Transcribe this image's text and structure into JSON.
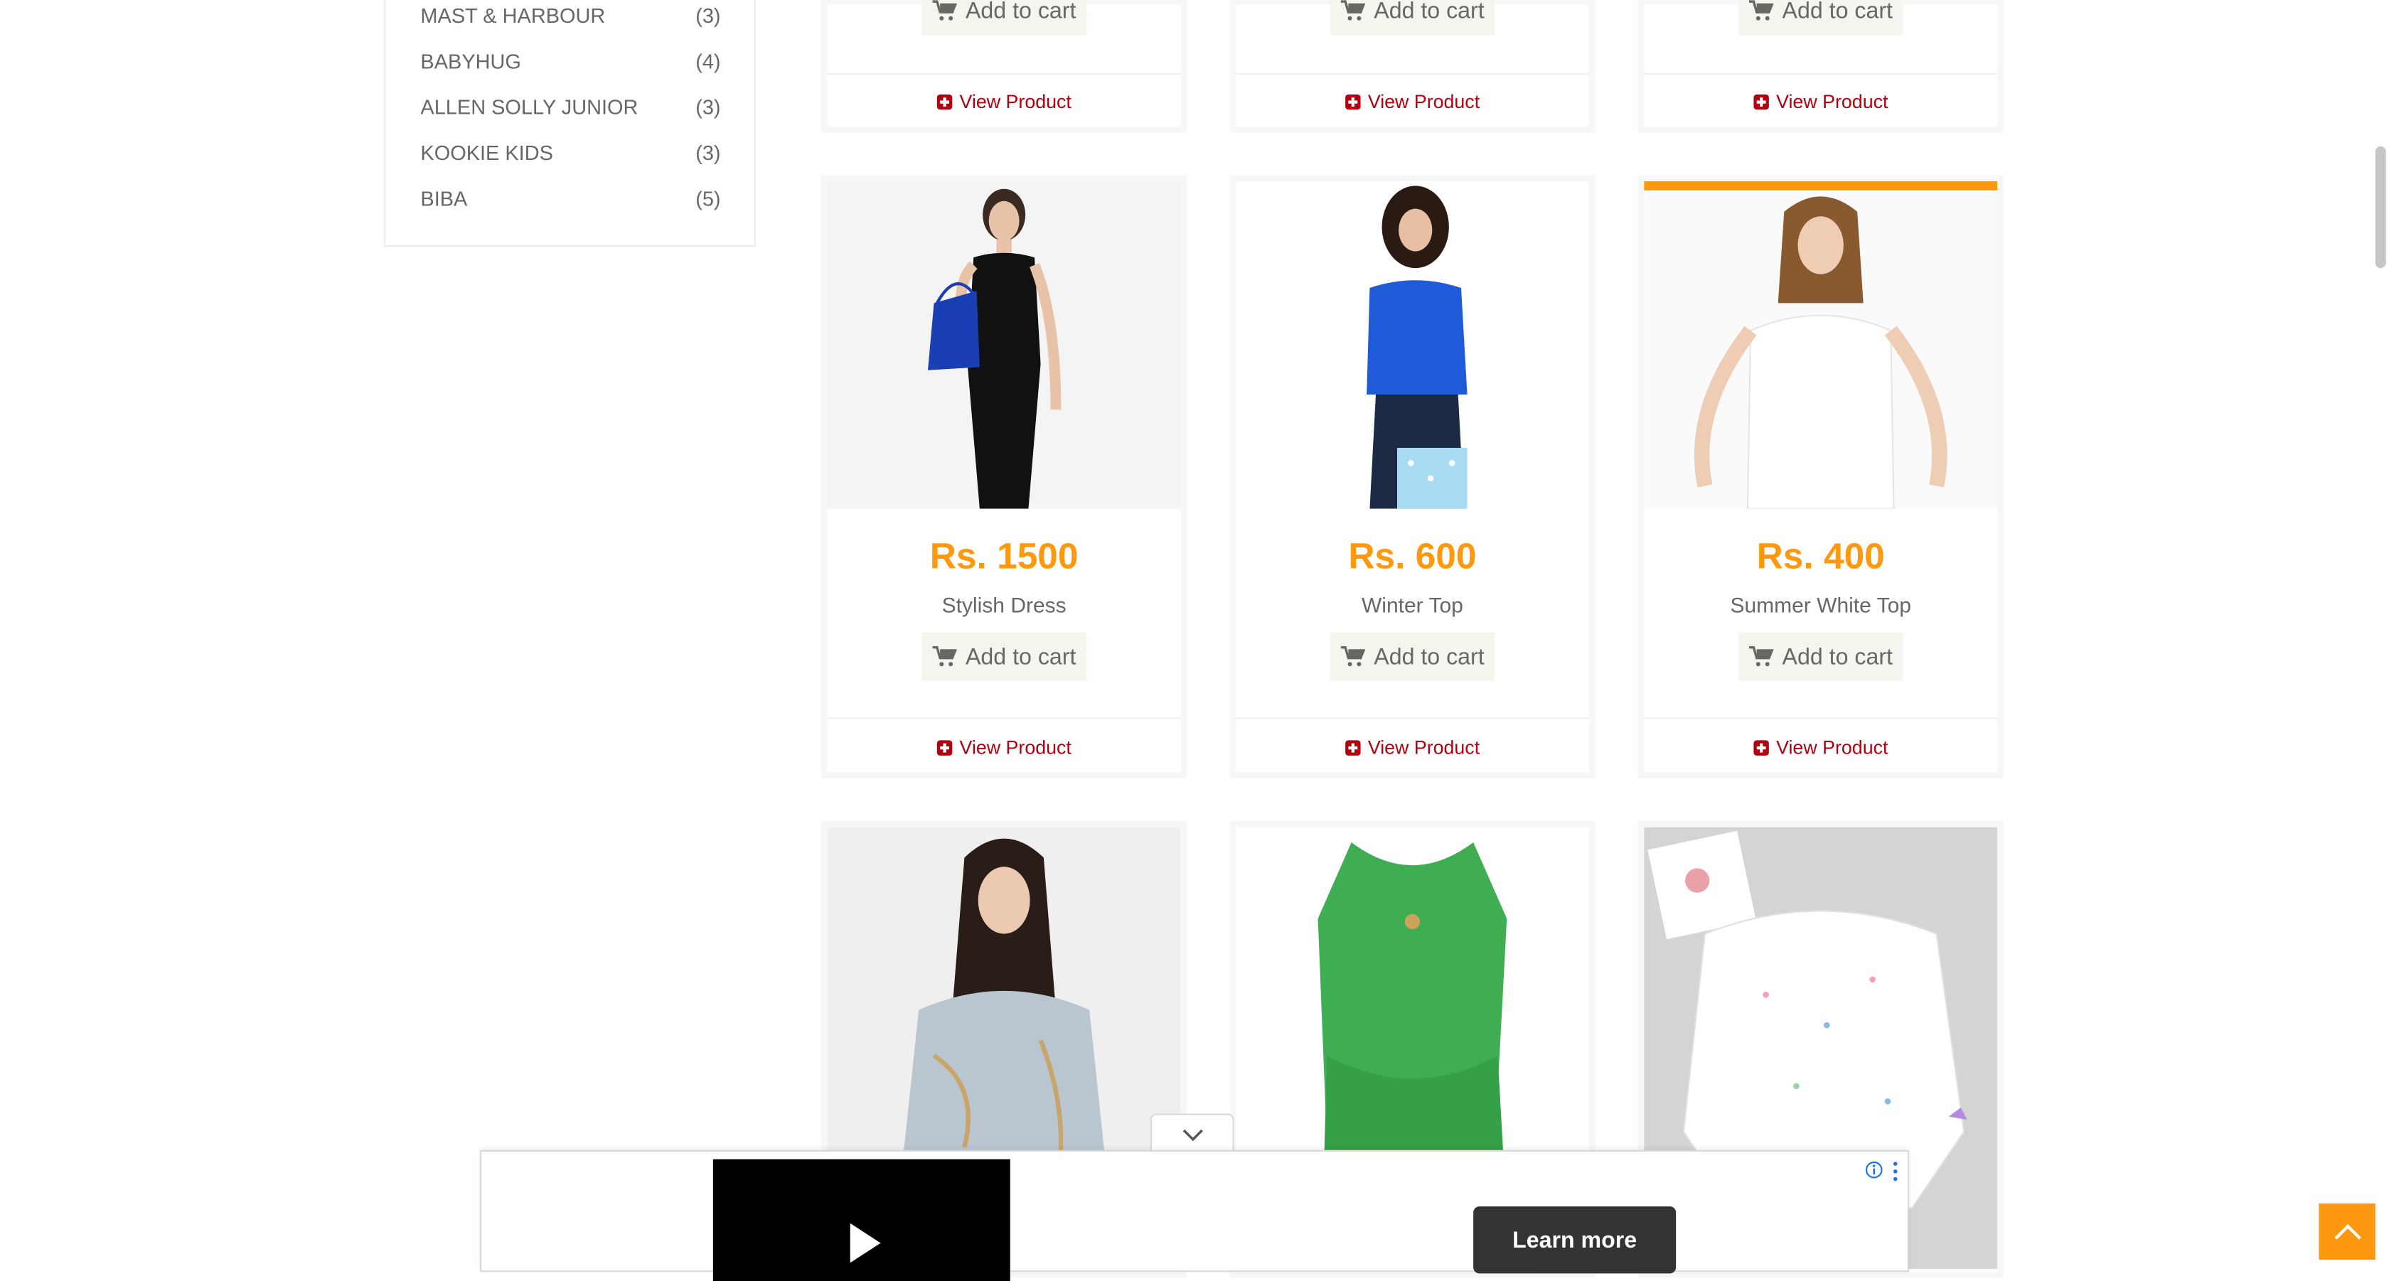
{
  "brands": [
    {
      "name": "MAST & HARBOUR",
      "count": "(3)"
    },
    {
      "name": "BABYHUG",
      "count": "(4)"
    },
    {
      "name": "ALLEN SOLLY JUNIOR",
      "count": "(3)"
    },
    {
      "name": "KOOKIE KIDS",
      "count": "(3)"
    },
    {
      "name": "BIBA",
      "count": "(5)"
    }
  ],
  "labels": {
    "add_to_cart": "Add to cart",
    "view_product": "View Product",
    "learn_more": "Learn more"
  },
  "products": [
    {
      "price": "Rs. 1500",
      "name": "Stylish Dress"
    },
    {
      "price": "Rs. 600",
      "name": "Winter Top"
    },
    {
      "price": "Rs. 400",
      "name": "Summer White Top"
    }
  ],
  "colors": {
    "price": "#FE980F",
    "view_link": "#B3000E",
    "cart_button_bg": "#F5F5ED",
    "accent": "#FE980F"
  },
  "icons": {
    "cart": "shopping-cart-icon",
    "view": "plus-square-icon",
    "back_to_top": "chevron-up-icon",
    "ad_collapse": "chevron-down-icon",
    "ad_play": "play-icon",
    "ad_info": "info-icon",
    "ad_menu": "kebab-menu-icon"
  }
}
